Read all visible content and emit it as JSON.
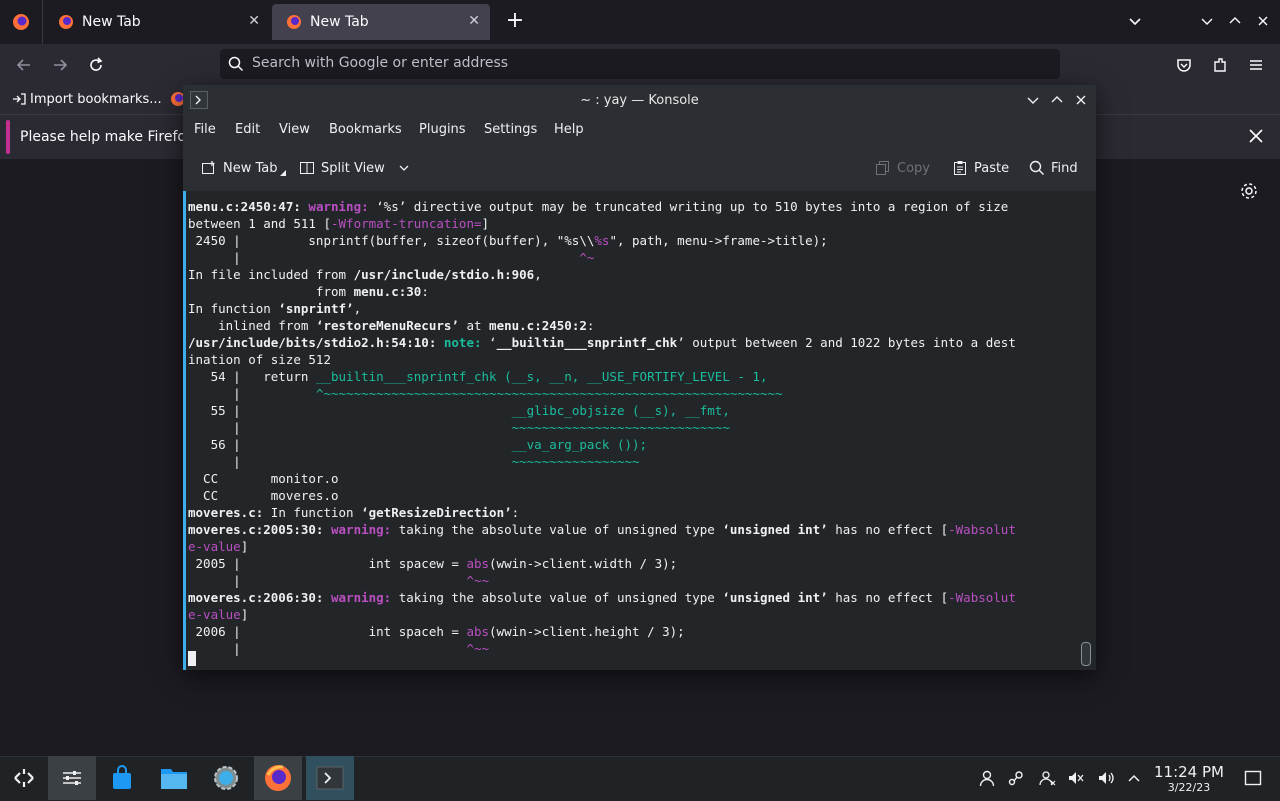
{
  "firefox": {
    "tabs": [
      {
        "label": "New Tab",
        "close": "✕"
      },
      {
        "label": "New Tab",
        "close": "✕"
      }
    ],
    "new_tab": "+",
    "urlbar_placeholder": "Search with Google or enter address",
    "bookmarks": {
      "import_label": "Import bookmarks..."
    },
    "notification": {
      "text": "Please help make Firefox b"
    }
  },
  "konsole": {
    "title": "~ : yay — Konsole",
    "menu": [
      "File",
      "Edit",
      "View",
      "Bookmarks",
      "Plugins",
      "Settings",
      "Help"
    ],
    "toolbar": {
      "new_tab": "New Tab",
      "split_view": "Split View",
      "copy": "Copy",
      "paste": "Paste",
      "find": "Find"
    },
    "terminal_lines": [
      [
        {
          "t": "menu.c:2450:47: ",
          "c": "b"
        },
        {
          "t": "warning: ",
          "c": "warn"
        },
        {
          "t": "‘%s’ directive output may be truncated writing up to 510 bytes into a region of size"
        }
      ],
      [
        {
          "t": "between 1 and 511 ["
        },
        {
          "t": "-Wformat-truncation=",
          "c": "mag"
        },
        {
          "t": "]"
        }
      ],
      [
        {
          "t": " 2450 |         snprintf(buffer, sizeof(buffer), \"%s\\\\"
        },
        {
          "t": "%s",
          "c": "mag"
        },
        {
          "t": "\", path, menu->frame->title);"
        }
      ],
      [
        {
          "t": "      |                                             "
        },
        {
          "t": "^~",
          "c": "mag"
        }
      ],
      [
        {
          "t": "In file included from "
        },
        {
          "t": "/usr/include/stdio.h:906",
          "c": "b"
        },
        {
          "t": ","
        }
      ],
      [
        {
          "t": "                 from "
        },
        {
          "t": "menu.c:30",
          "c": "b"
        },
        {
          "t": ":"
        }
      ],
      [
        {
          "t": "In function "
        },
        {
          "t": "‘snprintf’",
          "c": "b"
        },
        {
          "t": ","
        }
      ],
      [
        {
          "t": "    inlined from "
        },
        {
          "t": "‘restoreMenuRecurs’",
          "c": "b"
        },
        {
          "t": " at "
        },
        {
          "t": "menu.c:2450:2",
          "c": "b"
        },
        {
          "t": ":"
        }
      ],
      [
        {
          "t": "/usr/include/bits/stdio2.h:54:10: ",
          "c": "b"
        },
        {
          "t": "note: ",
          "c": "note"
        },
        {
          "t": "‘"
        },
        {
          "t": "__builtin___snprintf_chk",
          "c": "b"
        },
        {
          "t": "’ output between 2 and 1022 bytes into a dest"
        }
      ],
      [
        {
          "t": "ination of size 512"
        }
      ],
      [
        {
          "t": "   54 |   return "
        },
        {
          "t": "__builtin___snprintf_chk (__s, __n, __USE_FORTIFY_LEVEL - 1,",
          "c": "grn"
        }
      ],
      [
        {
          "t": "      |          "
        },
        {
          "t": "^~~~~~~~~~~~~~~~~~~~~~~~~~~~~~~~~~~~~~~~~~~~~~~~~~~~~~~~~~~~~~",
          "c": "grn"
        }
      ],
      [
        {
          "t": "   55 |                                    "
        },
        {
          "t": "__glibc_objsize (__s), __fmt,",
          "c": "grn"
        }
      ],
      [
        {
          "t": "      |                                    "
        },
        {
          "t": "~~~~~~~~~~~~~~~~~~~~~~~~~~~~~",
          "c": "grn"
        }
      ],
      [
        {
          "t": "   56 |                                    "
        },
        {
          "t": "__va_arg_pack ());",
          "c": "grn"
        }
      ],
      [
        {
          "t": "      |                                    "
        },
        {
          "t": "~~~~~~~~~~~~~~~~~",
          "c": "grn"
        }
      ],
      [
        {
          "t": "  CC       monitor.o"
        }
      ],
      [
        {
          "t": "  CC       moveres.o"
        }
      ],
      [
        {
          "t": "moveres.c:",
          "c": "b"
        },
        {
          "t": " In function "
        },
        {
          "t": "‘getResizeDirection’",
          "c": "b"
        },
        {
          "t": ":"
        }
      ],
      [
        {
          "t": "moveres.c:2005:30: ",
          "c": "b"
        },
        {
          "t": "warning: ",
          "c": "warn"
        },
        {
          "t": "taking the absolute value of unsigned type "
        },
        {
          "t": "‘unsigned int’",
          "c": "b"
        },
        {
          "t": " has no effect ["
        },
        {
          "t": "-Wabsolut",
          "c": "mag"
        }
      ],
      [
        {
          "t": "e-value",
          "c": "mag"
        },
        {
          "t": "]"
        }
      ],
      [
        {
          "t": " 2005 |                 int spacew = "
        },
        {
          "t": "abs",
          "c": "mag"
        },
        {
          "t": "(wwin->client.width / 3);"
        }
      ],
      [
        {
          "t": "      |                              "
        },
        {
          "t": "^~~",
          "c": "mag"
        }
      ],
      [
        {
          "t": "moveres.c:2006:30: ",
          "c": "b"
        },
        {
          "t": "warning: ",
          "c": "warn"
        },
        {
          "t": "taking the absolute value of unsigned type "
        },
        {
          "t": "‘unsigned int’",
          "c": "b"
        },
        {
          "t": " has no effect ["
        },
        {
          "t": "-Wabsolut",
          "c": "mag"
        }
      ],
      [
        {
          "t": "e-value",
          "c": "mag"
        },
        {
          "t": "]"
        }
      ],
      [
        {
          "t": " 2006 |                 int spaceh = "
        },
        {
          "t": "abs",
          "c": "mag"
        },
        {
          "t": "(wwin->client.height / 3);"
        }
      ],
      [
        {
          "t": "      |                              "
        },
        {
          "t": "^~~",
          "c": "mag"
        }
      ]
    ]
  },
  "taskbar": {
    "clock_time": "11:24 PM",
    "clock_date": "3/22/23"
  },
  "colors": {
    "accent": "#3daee9",
    "warning": "#b94fc1",
    "note": "#1abc9c",
    "notification_accent": "#c42f92"
  }
}
